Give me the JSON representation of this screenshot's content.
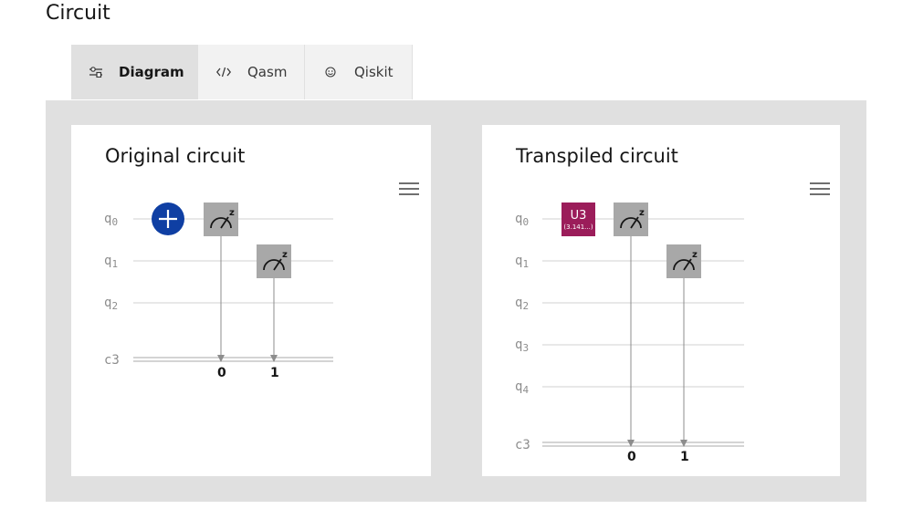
{
  "page": {
    "title": "Circuit"
  },
  "tabs": [
    {
      "label": "Diagram",
      "icon": "diagram-icon",
      "active": true
    },
    {
      "label": "Qasm",
      "icon": "code-icon",
      "active": false
    },
    {
      "label": "Qiskit",
      "icon": "qiskit-icon",
      "active": false
    }
  ],
  "original": {
    "title": "Original circuit",
    "qubits": [
      "q",
      "q",
      "q"
    ],
    "qubit_subscripts": [
      "0",
      "1",
      "2"
    ],
    "classical_label": "c3",
    "gates": [
      {
        "type": "X",
        "qubit": 0,
        "color": "#0f3fa3"
      },
      {
        "type": "measure",
        "qubit": 0,
        "to_bit": "0",
        "label": "z"
      },
      {
        "type": "measure",
        "qubit": 1,
        "to_bit": "1",
        "label": "z"
      }
    ]
  },
  "transpiled": {
    "title": "Transpiled circuit",
    "qubits": [
      "q",
      "q",
      "q",
      "q",
      "q"
    ],
    "qubit_subscripts": [
      "0",
      "1",
      "2",
      "3",
      "4"
    ],
    "classical_label": "c3",
    "gates": [
      {
        "type": "U3",
        "qubit": 0,
        "label": "U3",
        "param": "(3.141...)",
        "color": "#9b1d5a"
      },
      {
        "type": "measure",
        "qubit": 0,
        "to_bit": "0",
        "label": "z"
      },
      {
        "type": "measure",
        "qubit": 1,
        "to_bit": "1",
        "label": "z"
      }
    ]
  },
  "colors": {
    "measure_gate": "#a8a8a8",
    "wire": "#d0d0d0",
    "arrow": "#8d8d8d"
  }
}
